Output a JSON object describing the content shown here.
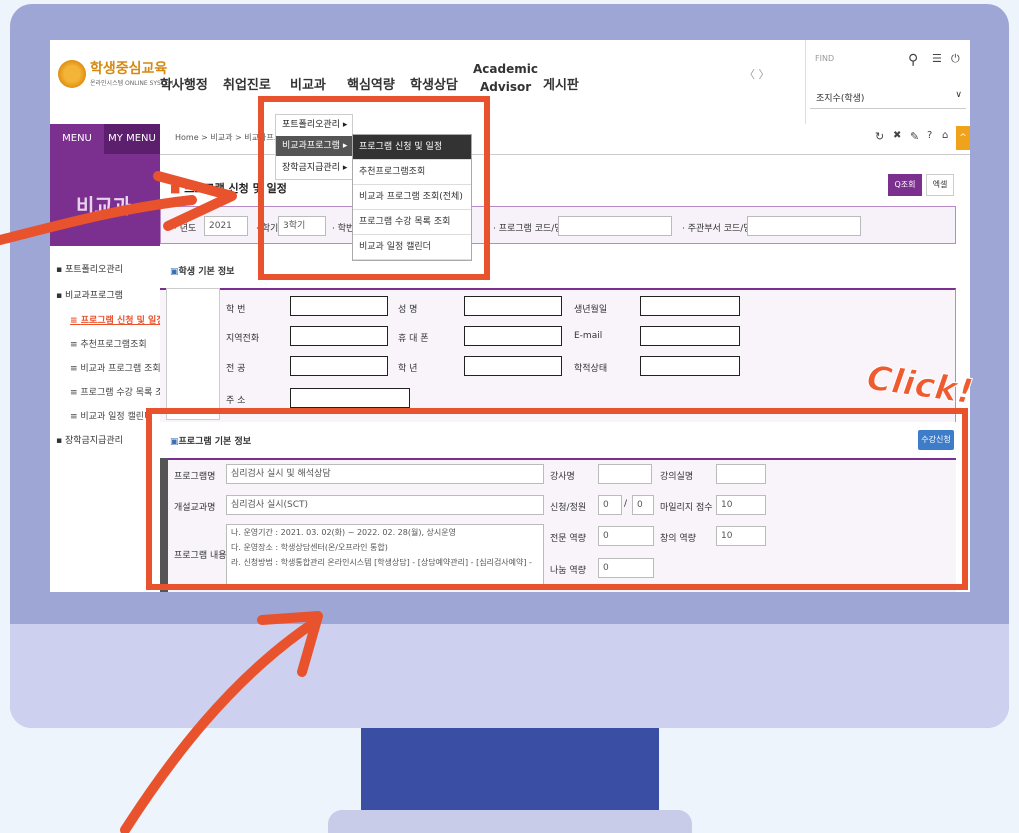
{
  "logo": {
    "title": "학생중심교육",
    "subtitle": "온라인시스템 ONLINE SYSTEM"
  },
  "nav": {
    "items": [
      "학사행정",
      "취업진로",
      "비교과",
      "핵심역량",
      "학생상담"
    ],
    "academic_line1": "Academic",
    "academic_line2": "Advisor",
    "board": "게시판",
    "arrows": "〈 〉"
  },
  "top_right": {
    "find_placeholder": "FIND",
    "user_select": "조지수(학생)"
  },
  "sidebar": {
    "tab_menu": "MENU",
    "tab_my_menu": "MY MENU",
    "banner": "비교과",
    "items": [
      "포트폴리오관리",
      "비교과프로그램",
      "장학금지급관리"
    ],
    "subitems": [
      "프로그램 신청 및 일정",
      "추천프로그램조회",
      "비교과 프로그램 조회(전체",
      "프로그램 수강 목록 조회",
      "비교과 일정 캘린더"
    ]
  },
  "breadcrumb": "Home > 비교과 > 비교과프로그램",
  "page_title": "프로그램 신청 및 일정",
  "buttons": {
    "search": "Q조회",
    "excel": "엑셀",
    "apply": "수강신청"
  },
  "filters": {
    "year_label": "· 년도",
    "year_value": "2021",
    "term_label": "· 학기",
    "term_value": "3학기",
    "student_id_label": "· 학번",
    "program_code_label": "· 프로그램 코드/명",
    "dept_code_label": "· 주관부서 코드/명"
  },
  "dropdown": {
    "level1": [
      "포트폴리오관리",
      "비교과프로그램",
      "장학금지급관리"
    ],
    "level2": [
      "프로그램 신청 및 일정",
      "추천프로그램조회",
      "비교과 프로그램 조회(전체)",
      "프로그램 수강 목록 조회",
      "비교과 일정 캘린더"
    ]
  },
  "student": {
    "section_title": "학생 기본 정보",
    "labels": [
      "학 번",
      "지역전화",
      "전 공",
      "주 소"
    ],
    "labels_mid": [
      "성 명",
      "휴 대 폰",
      "학 년"
    ],
    "labels_right": [
      "생년월일",
      "E-mail",
      "학적상태"
    ]
  },
  "program": {
    "section_title": "프로그램 기본 정보",
    "name_label": "프로그램명",
    "name_value": "심리검사 실시 및 해석상담",
    "course_label": "개설교과명",
    "course_value": "심리검사 실시(SCT)",
    "content_label": "프로그램 내용",
    "content_lines": [
      "나. 운영기간 : 2021. 03. 02(화) ~ 2022. 02. 28(월), 상시운영",
      "다. 운영장소 : 학생상담센터(온/오프라인 통합)",
      "라. 신청방법 : 학생통합관리 온라인시스템 [학생상담] - [상담예약관리] - [심리검사예약] -"
    ],
    "lecturer_label": "강사명",
    "lecture_room_label": "강의실명",
    "apply_label": "신청/정원",
    "apply_value": "0",
    "capacity_value": "0",
    "mileage_label": "마일리지 점수",
    "mileage_value": "10",
    "major_comp_label": "전문 역량",
    "major_comp_value": "0",
    "creative_comp_label": "창의 역량",
    "creative_comp_value": "10",
    "share_comp_label": "나눔 역량",
    "share_comp_value": "0"
  },
  "annotation": {
    "click": "Click!"
  },
  "colors": {
    "accent_purple": "#7b2f8f",
    "highlight_red": "#e8532e",
    "monitor": "#9ea6d6",
    "stand": "#3a4ea4"
  }
}
